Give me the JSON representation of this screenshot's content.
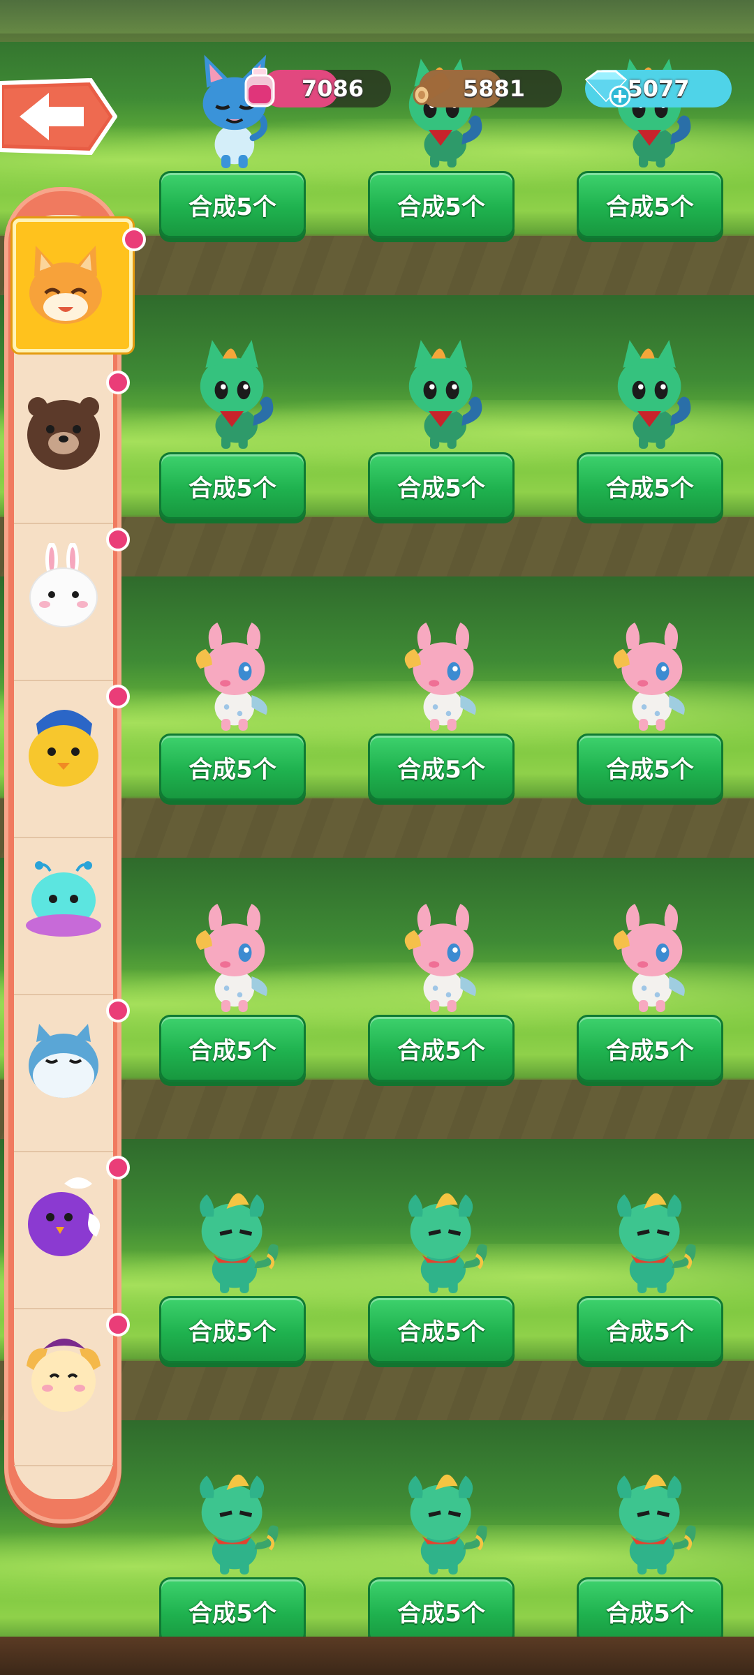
{
  "hud": {
    "back_icon": "arrow-left-icon",
    "resources": [
      {
        "name": "potion",
        "icon": "potion-icon",
        "value": "7086",
        "color": "#e2487f"
      },
      {
        "name": "wood",
        "icon": "wood-log-icon",
        "value": "5881",
        "color": "#9c6b3e"
      },
      {
        "name": "diamond",
        "icon": "diamond-plus-icon",
        "value": "5077",
        "color": "#4fd3e8"
      }
    ]
  },
  "sidebar": {
    "items": [
      {
        "pet": "orange-cat",
        "selected": true,
        "badge": true
      },
      {
        "pet": "brown-bear",
        "selected": false,
        "badge": true
      },
      {
        "pet": "white-rabbit",
        "selected": false,
        "badge": true
      },
      {
        "pet": "yellow-chick",
        "selected": false,
        "badge": true
      },
      {
        "pet": "cyan-jellyfish",
        "selected": false,
        "badge": false
      },
      {
        "pet": "blue-seal",
        "selected": false,
        "badge": true
      },
      {
        "pet": "purple-bird",
        "selected": false,
        "badge": true
      },
      {
        "pet": "cream-cow",
        "selected": false,
        "badge": true
      }
    ]
  },
  "grid": {
    "button_label": "合成5个",
    "rows": [
      {
        "pets": [
          "blue-cat",
          "green-dragon",
          "green-dragon"
        ]
      },
      {
        "pets": [
          "green-dragon",
          "green-dragon",
          "green-dragon"
        ]
      },
      {
        "pets": [
          "pink-deer",
          "pink-deer",
          "pink-deer"
        ]
      },
      {
        "pets": [
          "pink-deer",
          "pink-deer",
          "pink-deer"
        ]
      },
      {
        "pets": [
          "teal-qilin",
          "teal-qilin",
          "teal-qilin"
        ]
      },
      {
        "pets": [
          "teal-qilin",
          "teal-qilin",
          "teal-qilin"
        ]
      }
    ]
  },
  "colors": {
    "button_green": "#1fb24f",
    "sidebar_coral": "#f07a5f",
    "sidebar_cream": "#f6dfc5",
    "selected_yellow": "#ffc21d",
    "badge_pink": "#ea3d78"
  }
}
